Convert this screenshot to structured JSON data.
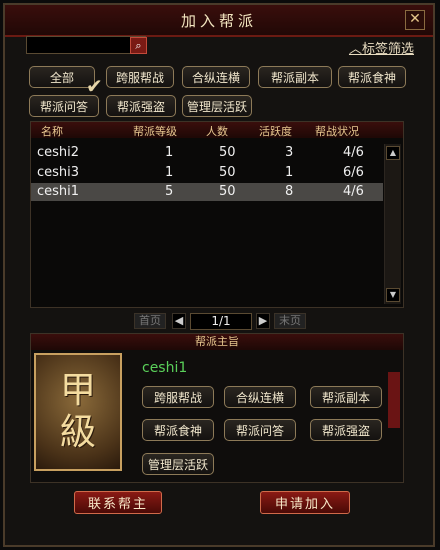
{
  "window": {
    "title": "加入帮派",
    "close_icon": "close-icon"
  },
  "search": {
    "placeholder": "",
    "icon": "search-icon"
  },
  "tag_filter": {
    "label": "标签筛选",
    "icon": "chevron-up-icon"
  },
  "filters": [
    "全部",
    "跨服帮战",
    "合纵连横",
    "帮派副本",
    "帮派食神",
    "帮派问答",
    "帮派强盗",
    "管理层活跃"
  ],
  "table": {
    "headers": [
      "名称",
      "帮派等级",
      "人数",
      "活跃度",
      "帮战状况"
    ],
    "rows": [
      {
        "name": "ceshi2",
        "level": "1",
        "members": "50",
        "activity": "3",
        "war": "4/6"
      },
      {
        "name": "ceshi3",
        "level": "1",
        "members": "50",
        "activity": "1",
        "war": "6/6"
      },
      {
        "name": "ceshi1",
        "level": "5",
        "members": "50",
        "activity": "8",
        "war": "4/6"
      }
    ],
    "selected_index": 2
  },
  "pager": {
    "first": "首页",
    "page": "1/1",
    "last": "末页"
  },
  "detail": {
    "section_title": "帮派主旨",
    "emblem_lines": [
      "甲",
      "級"
    ],
    "guild_name": "ceshi1",
    "tags": [
      "跨服帮战",
      "合纵连横",
      "帮派副本",
      "帮派食神",
      "帮派问答",
      "帮派强盗",
      "管理层活跃"
    ]
  },
  "actions": {
    "contact": "联系帮主",
    "apply": "申请加入"
  }
}
